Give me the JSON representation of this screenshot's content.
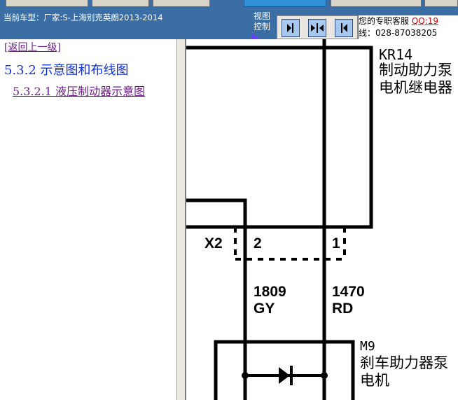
{
  "header": {
    "current_model": "当前车型：厂家:S-上海别克英朗2013-2014",
    "view_control_label": "视图控制",
    "service_line1": "您的专职客服",
    "service_qq": "QQ:19",
    "service_line2": "线：028-87038205"
  },
  "view_buttons": [
    {
      "name": "panel-left",
      "icon": "arrow-right-to-bar-icon"
    },
    {
      "name": "panel-split",
      "icon": "arrows-inward-icon"
    },
    {
      "name": "panel-right",
      "icon": "arrow-left-from-bar-icon"
    }
  ],
  "nav": {
    "back_link": "[返回上一级]",
    "section_title": "5.3.2 示意图和布线图",
    "subsection_link": "5.3.2.1 液压制动器示意图"
  },
  "diagram": {
    "relay_id": "KR14",
    "relay_name": "制动助力泵电机继电器",
    "connector_id": "X2",
    "pin_left": "2",
    "pin_right": "1",
    "wire_left_circuit": "1809",
    "wire_left_color": "GY",
    "wire_right_circuit": "1470",
    "wire_right_color": "RD",
    "motor_id": "M9",
    "motor_name": "刹车助力器泵电机"
  },
  "colors": {
    "header_bg": "#3b6ea5",
    "link_visited": "#6f1d8a",
    "link_title": "#1030d8",
    "qq_text": "#e00000"
  }
}
